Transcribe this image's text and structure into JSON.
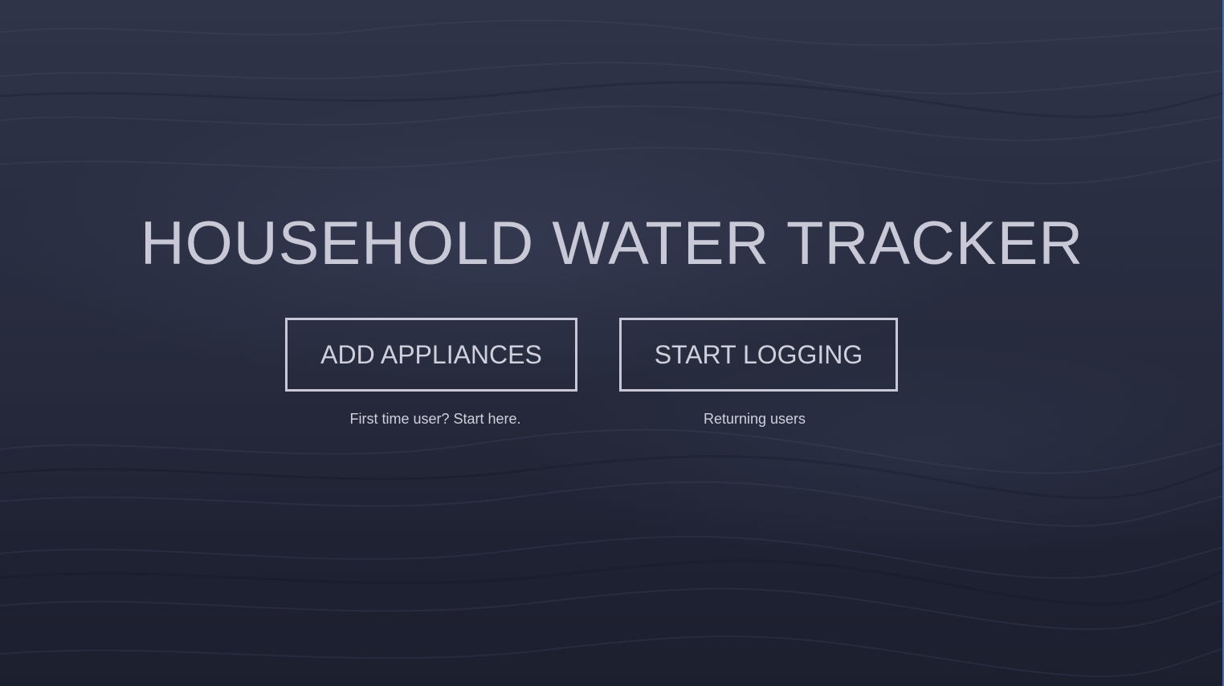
{
  "page": {
    "title": "HOUSEHOLD WATER TRACKER"
  },
  "actions": {
    "add_appliances": {
      "label": "ADD APPLIANCES",
      "caption": "First time user? Start here."
    },
    "start_logging": {
      "label": "START LOGGING",
      "caption": "Returning users"
    }
  },
  "colors": {
    "background": "#262a3c",
    "text": "#c9c8d6"
  }
}
